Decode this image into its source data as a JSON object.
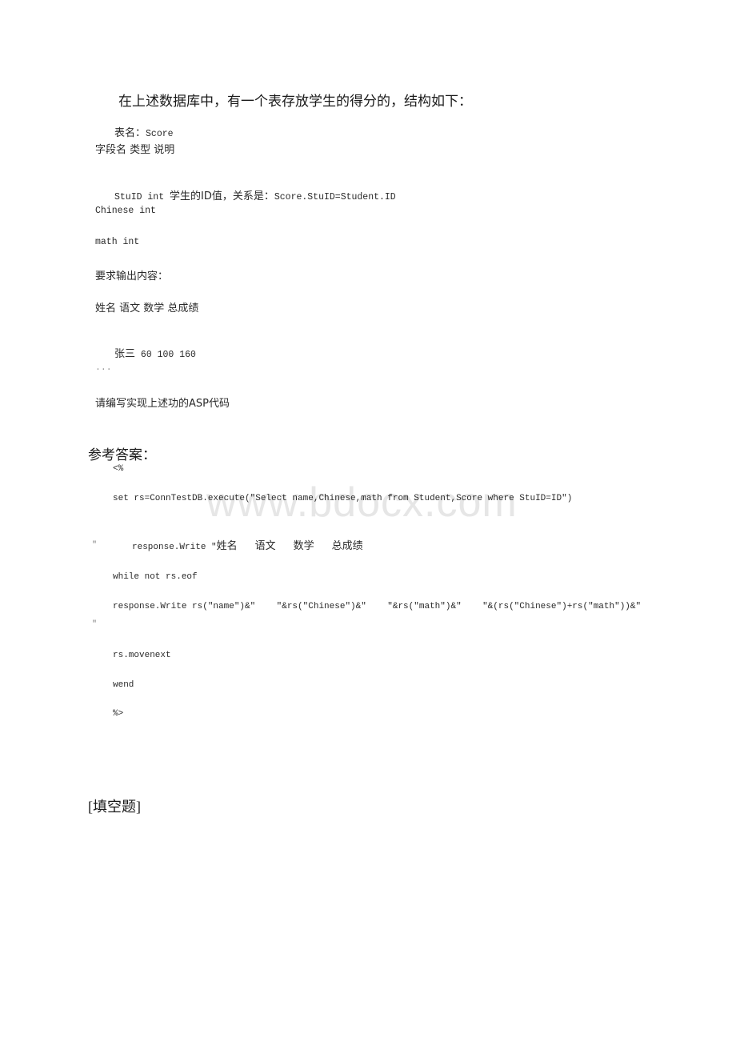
{
  "question": {
    "intro": "在上述数据库中，有一个表存放学生的得分的，结构如下：",
    "lines": [
      {
        "cjk": "表名：",
        "mono": "Score"
      },
      {
        "cjk": "字段名 类型 说明",
        "mono": ""
      },
      {
        "mono1": "StuID int ",
        "cjk": "学生的ID值，关系是：",
        "mono2": "Score.StuID=Student.ID"
      },
      {
        "mono": "Chinese int"
      },
      {
        "mono": "math int"
      },
      {
        "cjk": "要求输出内容："
      },
      {
        "cjk": "姓名 语文 数学 总成绩"
      },
      {
        "cjk": "张三",
        "mono": " 60 100 160"
      },
      {
        "mono": "..."
      },
      {
        "cjk": "请编写实现上述功的ASP代码"
      }
    ]
  },
  "answer": {
    "label": "参考答案：",
    "code": {
      "open_tag": "<%",
      "line_set": "set rs=ConnTestDB.execute(\"Select name,Chinese,math from Student,Score where StuID=ID\")",
      "line_write_header_prefix": "response.Write \"",
      "line_write_header_cols": [
        "姓名",
        "语文",
        "数学",
        "总成绩"
      ],
      "line_write_header_close": "\"",
      "line_while": "while not rs.eof",
      "line_write_row": "response.Write rs(\"name\")&\"    \"&rs(\"Chinese\")&\"    \"&rs(\"math\")&\"    \"&(rs(\"Chinese\")+rs(\"math\"))&\"",
      "line_write_row_close": "\"",
      "line_movenext": "rs.movenext",
      "line_wend": "wend",
      "close_tag": "%>"
    }
  },
  "next_section": "[填空题]",
  "watermark": "www.bdocx.com"
}
